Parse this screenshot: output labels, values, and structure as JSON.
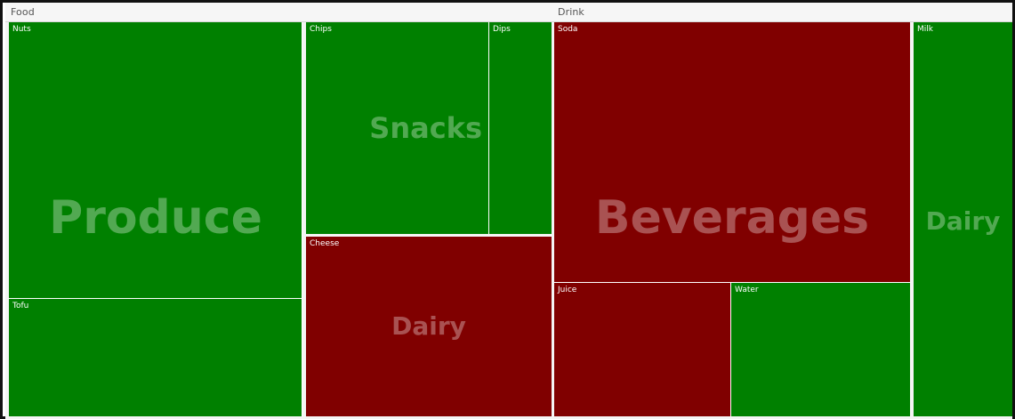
{
  "chart_data": {
    "type": "treemap",
    "colors": {
      "positive": "#008000",
      "negative": "#800000"
    },
    "groups": [
      {
        "name": "Food",
        "categories": [
          {
            "name": "Produce",
            "items": [
              {
                "name": "Nuts",
                "status": "positive"
              },
              {
                "name": "Tofu",
                "status": "positive"
              }
            ]
          },
          {
            "name": "Snacks",
            "items": [
              {
                "name": "Chips",
                "status": "positive"
              },
              {
                "name": "Dips",
                "status": "positive"
              }
            ]
          },
          {
            "name": "Dairy",
            "items": [
              {
                "name": "Cheese",
                "status": "negative"
              }
            ]
          }
        ]
      },
      {
        "name": "Drink",
        "categories": [
          {
            "name": "Beverages",
            "items": [
              {
                "name": "Soda",
                "status": "negative"
              },
              {
                "name": "Juice",
                "status": "negative"
              },
              {
                "name": "Water",
                "status": "positive"
              }
            ]
          },
          {
            "name": "Dairy",
            "items": [
              {
                "name": "Milk",
                "status": "positive"
              }
            ]
          }
        ]
      }
    ]
  }
}
